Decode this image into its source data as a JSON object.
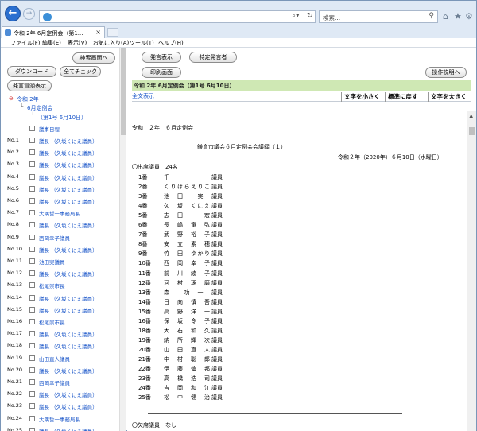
{
  "browser": {
    "search_placeholder": "検索...",
    "tab_title": "令和 2年 6月定例会（第1...",
    "menu": [
      "ファイル(F)",
      "編集(E)",
      "表示(V)",
      "お気に入り(A)",
      "ツール(T)",
      "ヘルプ(H)"
    ]
  },
  "left": {
    "search_screen_btn": "検索画面へ",
    "download_btn": "ダウンロード",
    "check_all_btn": "全てチェック",
    "speakers_btn": "発言冒頭表示",
    "tree_year": "令和 2年",
    "tree_session": "6月定例会",
    "tree_day": "（第1号 6月10日）",
    "tree_agenda": "議事日程",
    "rows": [
      {
        "no": "No.1",
        "label": "議長 （久坂くにえ議員）"
      },
      {
        "no": "No.2",
        "label": "議長 （久坂くにえ議員）"
      },
      {
        "no": "No.3",
        "label": "議長 （久坂くにえ議員）"
      },
      {
        "no": "No.4",
        "label": "議長 （久坂くにえ議員）"
      },
      {
        "no": "No.5",
        "label": "議長 （久坂くにえ議員）"
      },
      {
        "no": "No.6",
        "label": "議長 （久坂くにえ議員）"
      },
      {
        "no": "No.7",
        "label": "大隅哲一事務局長"
      },
      {
        "no": "No.8",
        "label": "議長 （久坂くにえ議員）"
      },
      {
        "no": "No.9",
        "label": "西岡幸子議員"
      },
      {
        "no": "No.10",
        "label": "議長 （久坂くにえ議員）"
      },
      {
        "no": "No.11",
        "label": "池田実議員"
      },
      {
        "no": "No.12",
        "label": "議長 （久坂くにえ議員）"
      },
      {
        "no": "No.13",
        "label": "松尾崇市長"
      },
      {
        "no": "No.14",
        "label": "議長 （久坂くにえ議員）"
      },
      {
        "no": "No.15",
        "label": "議長 （久坂くにえ議員）"
      },
      {
        "no": "No.16",
        "label": "松尾崇市長"
      },
      {
        "no": "No.17",
        "label": "議長 （久坂くにえ議員）"
      },
      {
        "no": "No.18",
        "label": "議長 （久坂くにえ議員）"
      },
      {
        "no": "No.19",
        "label": "山田直人議員"
      },
      {
        "no": "No.20",
        "label": "議長 （久坂くにえ議員）"
      },
      {
        "no": "No.21",
        "label": "西岡幸子議員"
      },
      {
        "no": "No.22",
        "label": "議長 （久坂くにえ議員）"
      },
      {
        "no": "No.23",
        "label": "議長 （久坂くにえ議員）"
      },
      {
        "no": "No.24",
        "label": "大隅哲一事務局長"
      },
      {
        "no": "No.25",
        "label": "議長 （久坂くにえ議員）"
      }
    ]
  },
  "right": {
    "show_speech_btn": "発言表示",
    "specific_speaker_btn": "特定発言者",
    "print_screen_btn": "印刷画面",
    "help_btn": "操作説明へ",
    "meeting_title": "令和 2年 6月定例会（第1号 6月10日）",
    "full_text_link": "全文表示",
    "font_smaller": "文字を小さく",
    "font_reset": "標準に戻す",
    "font_larger": "文字を大きく",
    "doc_heading": "令和　２年　６月定例会",
    "doc_title": "鎌倉市議会６月定例会会議録（１）",
    "doc_date": "令和２年（2020年）６月10日（水曜日）",
    "attendees_label": "〇出席議員　24名",
    "members": [
      {
        "no": "1番",
        "name": "千　　一",
        "title": "議員"
      },
      {
        "no": "2番",
        "name": "くりはらえりこ",
        "title": "議員"
      },
      {
        "no": "3番",
        "name": "池　田　　実",
        "title": "議員"
      },
      {
        "no": "4番",
        "name": "久　坂　くにえ",
        "title": "議員"
      },
      {
        "no": "5番",
        "name": "志　田　一　宏",
        "title": "議員"
      },
      {
        "no": "6番",
        "name": "長　嶋　竜　弘",
        "title": "議員"
      },
      {
        "no": "7番",
        "name": "武　野　裕　子",
        "title": "議員"
      },
      {
        "no": "8番",
        "name": "安　立　素　穂",
        "title": "議員"
      },
      {
        "no": "9番",
        "name": "竹　田　ゆかり",
        "title": "議員"
      },
      {
        "no": "10番",
        "name": "西　岡　幸　子",
        "title": "議員"
      },
      {
        "no": "11番",
        "name": "前　川　綾　子",
        "title": "議員"
      },
      {
        "no": "12番",
        "name": "河　村　琢　磨",
        "title": "議員"
      },
      {
        "no": "13番",
        "name": "森　　功　一",
        "title": "議員"
      },
      {
        "no": "14番",
        "name": "日　向　慎　吾",
        "title": "議員"
      },
      {
        "no": "15番",
        "name": "高　野　洋　一",
        "title": "議員"
      },
      {
        "no": "16番",
        "name": "保　坂　令　子",
        "title": "議員"
      },
      {
        "no": "18番",
        "name": "大　石　和　久",
        "title": "議員"
      },
      {
        "no": "19番",
        "name": "納　所　輝　次",
        "title": "議員"
      },
      {
        "no": "20番",
        "name": "山　田　直　人",
        "title": "議員"
      },
      {
        "no": "21番",
        "name": "中　村　聡一郎",
        "title": "議員"
      },
      {
        "no": "22番",
        "name": "伊　藤　倫　邦",
        "title": "議員"
      },
      {
        "no": "23番",
        "name": "高　橋　浩　司",
        "title": "議員"
      },
      {
        "no": "24番",
        "name": "吉　岡　和　江",
        "title": "議員"
      },
      {
        "no": "25番",
        "name": "松　中　健　治",
        "title": "議員"
      }
    ],
    "absent_label": "〇欠席議員　なし"
  }
}
